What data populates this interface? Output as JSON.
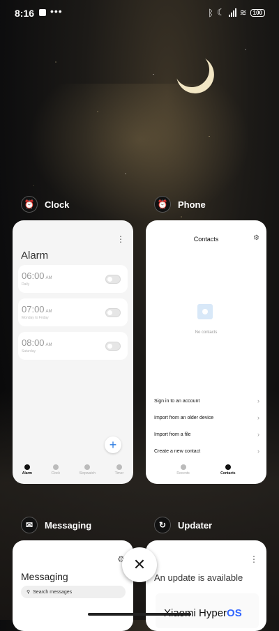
{
  "status_bar": {
    "time": "8:16",
    "battery": "100"
  },
  "apps": {
    "clock": {
      "label": "Clock",
      "title": "Alarm",
      "alarms": [
        {
          "time": "06:00",
          "ampm": "AM",
          "sub": "Daily"
        },
        {
          "time": "07:00",
          "ampm": "AM",
          "sub": "Monday to Friday"
        },
        {
          "time": "08:00",
          "ampm": "AM",
          "sub": "Saturday"
        }
      ],
      "nav": [
        "Alarm",
        "Clock",
        "Stopwatch",
        "Timer"
      ]
    },
    "phone": {
      "label": "Phone",
      "title": "Contacts",
      "empty_text": "No contacts",
      "menu": [
        "Sign in to an account",
        "Import from an older device",
        "Import from a file",
        "Create a new contact"
      ],
      "nav": [
        "Recents",
        "Contacts"
      ]
    },
    "messaging": {
      "label": "Messaging",
      "title": "Messaging",
      "search_placeholder": "Search messages"
    },
    "updater": {
      "label": "Updater",
      "title": "An update is available",
      "brand_prefix": "Xiaomi Hyper",
      "brand_suffix": "OS"
    }
  },
  "icons": {
    "close": "close-icon",
    "accent": "#2f7de1"
  }
}
